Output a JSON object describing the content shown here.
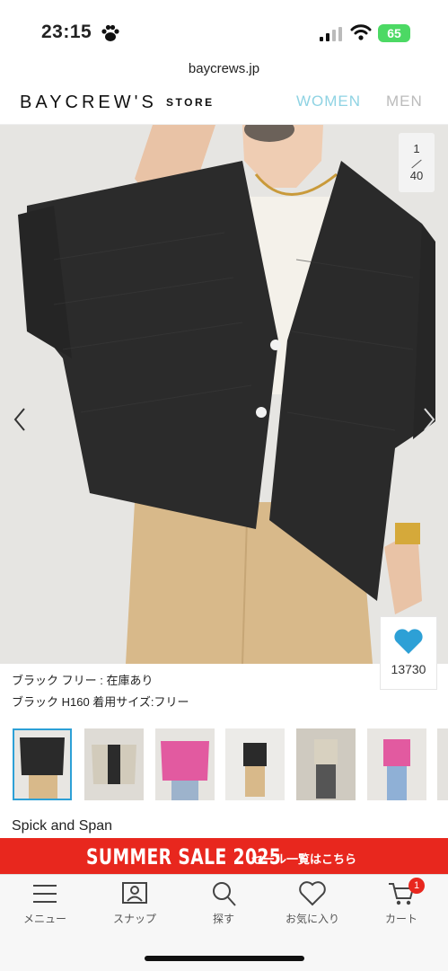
{
  "status_bar": {
    "time": "23:15",
    "battery": "65",
    "url": "baycrews.jp"
  },
  "header": {
    "logo": "BAYCREW'S",
    "logo_sub": "STORE",
    "nav": [
      "WOMEN",
      "MEN"
    ]
  },
  "gallery": {
    "current": "1",
    "total": "40"
  },
  "favorite": {
    "count": "13730"
  },
  "product": {
    "variant_stock": "ブラック フリー : 在庫あり",
    "model_info": "ブラック H160 着用サイズ:フリー",
    "brand": "Spick and Span"
  },
  "sale_banner": {
    "title": "SUMMER SALE 2025",
    "link": "セール一覧はこちら"
  },
  "bottom_nav": {
    "items": [
      {
        "label": "メニュー",
        "icon": "menu-icon"
      },
      {
        "label": "スナップ",
        "icon": "snap-icon"
      },
      {
        "label": "探す",
        "icon": "search-icon"
      },
      {
        "label": "お気に入り",
        "icon": "heart-icon"
      },
      {
        "label": "カート",
        "icon": "cart-icon"
      }
    ],
    "cart_badge": "1"
  },
  "colors": {
    "accent": "#2da0d6",
    "sale_red": "#e8271e",
    "women_nav": "#8fd3e3"
  }
}
